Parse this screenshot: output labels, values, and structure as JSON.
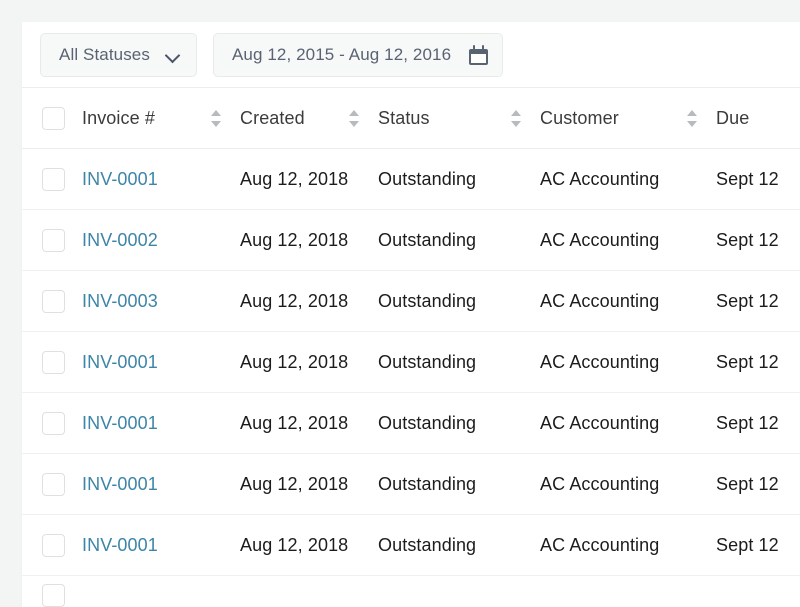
{
  "theme": {
    "page_bg": "#f3f4f4",
    "card_bg": "#ffffff",
    "link_color": "#3d85a8",
    "control_text": "#5a6372",
    "header_text": "#3b3b3b",
    "cell_text": "#1c1c1c",
    "divider": "#eceded"
  },
  "filters": {
    "status": {
      "selected_label": "All Statuses",
      "chevron_icon": "chevron-down-icon"
    },
    "date_range": {
      "value": "Aug 12, 2015 - Aug 12, 2016",
      "calendar_icon": "calendar-icon"
    }
  },
  "table": {
    "select_all_checkbox": false,
    "columns": [
      {
        "key": "invoice",
        "label": "Invoice #",
        "sortable": true
      },
      {
        "key": "created",
        "label": "Created",
        "sortable": true
      },
      {
        "key": "status",
        "label": "Status",
        "sortable": true
      },
      {
        "key": "customer",
        "label": "Customer",
        "sortable": true
      },
      {
        "key": "due",
        "label": "Due",
        "sortable": false
      }
    ],
    "rows": [
      {
        "checked": false,
        "invoice": "INV-0001",
        "created": "Aug 12, 2018",
        "status": "Outstanding",
        "customer": "AC Accounting",
        "due": "Sept 12"
      },
      {
        "checked": false,
        "invoice": "INV-0002",
        "created": "Aug 12, 2018",
        "status": "Outstanding",
        "customer": "AC Accounting",
        "due": "Sept 12"
      },
      {
        "checked": false,
        "invoice": "INV-0003",
        "created": "Aug 12, 2018",
        "status": "Outstanding",
        "customer": "AC Accounting",
        "due": "Sept 12"
      },
      {
        "checked": false,
        "invoice": "INV-0001",
        "created": "Aug 12, 2018",
        "status": "Outstanding",
        "customer": "AC Accounting",
        "due": "Sept 12"
      },
      {
        "checked": false,
        "invoice": "INV-0001",
        "created": "Aug 12, 2018",
        "status": "Outstanding",
        "customer": "AC Accounting",
        "due": "Sept 12"
      },
      {
        "checked": false,
        "invoice": "INV-0001",
        "created": "Aug 12, 2018",
        "status": "Outstanding",
        "customer": "AC Accounting",
        "due": "Sept 12"
      },
      {
        "checked": false,
        "invoice": "INV-0001",
        "created": "Aug 12, 2018",
        "status": "Outstanding",
        "customer": "AC Accounting",
        "due": "Sept 12"
      },
      {
        "checked": false,
        "invoice": "",
        "created": "",
        "status": "",
        "customer": "",
        "due": ""
      }
    ]
  }
}
